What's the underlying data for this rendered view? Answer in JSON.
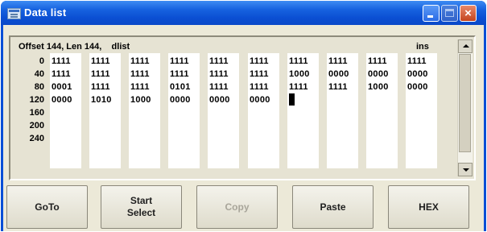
{
  "window": {
    "title": "Data list"
  },
  "editor": {
    "offset_label": "Offset 144, Len 144,    dlist",
    "mode_label": "ins",
    "row_labels": [
      "0",
      "40",
      "80",
      "120",
      "160",
      "200",
      "240"
    ],
    "data_rows": [
      [
        "1111",
        "1111",
        "1111",
        "1111",
        "1111",
        "1111",
        "1111",
        "1111",
        "1111",
        "1111"
      ],
      [
        "1111",
        "1111",
        "1111",
        "1111",
        "1111",
        "1111",
        "1000",
        "0000",
        "0000",
        "0000"
      ],
      [
        "0001",
        "1111",
        "1111",
        "0101",
        "1111",
        "1111",
        "1111",
        "1111",
        "1000",
        "0000"
      ],
      [
        "0000",
        "1010",
        "1000",
        "0000",
        "0000",
        "0000"
      ]
    ],
    "cursor_row": 3,
    "cursor_col": 6
  },
  "buttons": [
    {
      "label": "GoTo",
      "enabled": true
    },
    {
      "label": "Start\nSelect",
      "enabled": true
    },
    {
      "label": "Copy",
      "enabled": false
    },
    {
      "label": "Paste",
      "enabled": true
    },
    {
      "label": "HEX",
      "enabled": true
    }
  ],
  "colors": {
    "titlebar": "#0b4fd3",
    "panel": "#e6e3d3",
    "column": "#ffffff"
  }
}
